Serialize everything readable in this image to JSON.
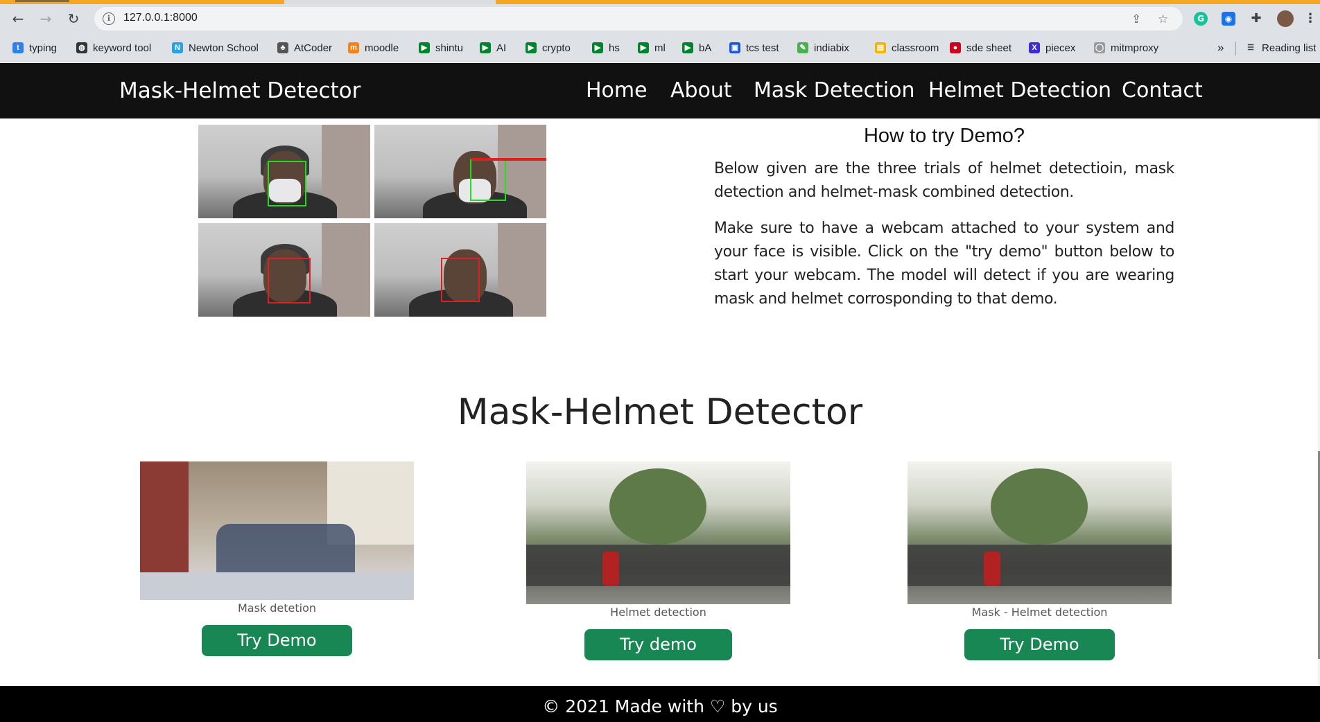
{
  "browser": {
    "url": "127.0.0.1:8000",
    "bookmarks": [
      {
        "label": "typing",
        "icon": "t-icon",
        "color": "#2f80ed"
      },
      {
        "label": "keyword tool",
        "icon": "globe-icon",
        "color": "#333333"
      },
      {
        "label": "Newton School",
        "icon": "newton-icon",
        "color": "#29a3e0"
      },
      {
        "label": "AtCoder",
        "icon": "atcoder-icon",
        "color": "#555555"
      },
      {
        "label": "moodle",
        "icon": "moodle-icon",
        "color": "#f98012"
      },
      {
        "label": "shintu",
        "icon": "meet-icon",
        "color": "#00832d"
      },
      {
        "label": "AI",
        "icon": "meet-icon",
        "color": "#00832d"
      },
      {
        "label": "crypto",
        "icon": "meet-icon",
        "color": "#00832d"
      },
      {
        "label": "hs",
        "icon": "meet-icon",
        "color": "#00832d"
      },
      {
        "label": "ml",
        "icon": "meet-icon",
        "color": "#00832d"
      },
      {
        "label": "bA",
        "icon": "meet-icon",
        "color": "#00832d"
      },
      {
        "label": "tcs test",
        "icon": "tcs-icon",
        "color": "#1a56db"
      },
      {
        "label": "indiabix",
        "icon": "indiabix-icon",
        "color": "#4caf50"
      },
      {
        "label": "classroom",
        "icon": "classroom-icon",
        "color": "#f4b400"
      },
      {
        "label": "sde sheet",
        "icon": "tuf-icon",
        "color": "#d0021b"
      },
      {
        "label": "piecex",
        "icon": "x-icon",
        "color": "#3d2bd6"
      },
      {
        "label": "mitmproxy",
        "icon": "github-icon",
        "color": "#999999"
      }
    ],
    "overflow": "»",
    "reading_list": "Reading list"
  },
  "site": {
    "brand": "Mask-Helmet Detector",
    "nav": [
      "Home",
      "About",
      "Mask Detection",
      "Helmet Detection",
      "Contact"
    ]
  },
  "howto": {
    "title": "How to try Demo?",
    "p1": "Below given are the three trials of helmet detectioin, mask detection and helmet-mask combined detection.",
    "p2": "Make sure to have a webcam attached to your system and your face is visible. Click on the \"try demo\" button below to start your webcam. The model will detect if you are wearing mask and helmet corrosponding to that demo."
  },
  "section": {
    "title": "Mask-Helmet Detector",
    "cards": [
      {
        "caption": "Mask detetion",
        "button": "Try Demo"
      },
      {
        "caption": "Helmet detection",
        "button": "Try demo"
      },
      {
        "caption": "Mask - Helmet detection",
        "button": "Try Demo"
      }
    ]
  },
  "footer": {
    "text": "© 2021 Made with ♡ by us"
  },
  "colors": {
    "button": "#198754",
    "navbar": "#111111",
    "mask_box": "#22dd22",
    "no_mask_box": "#e02020"
  }
}
